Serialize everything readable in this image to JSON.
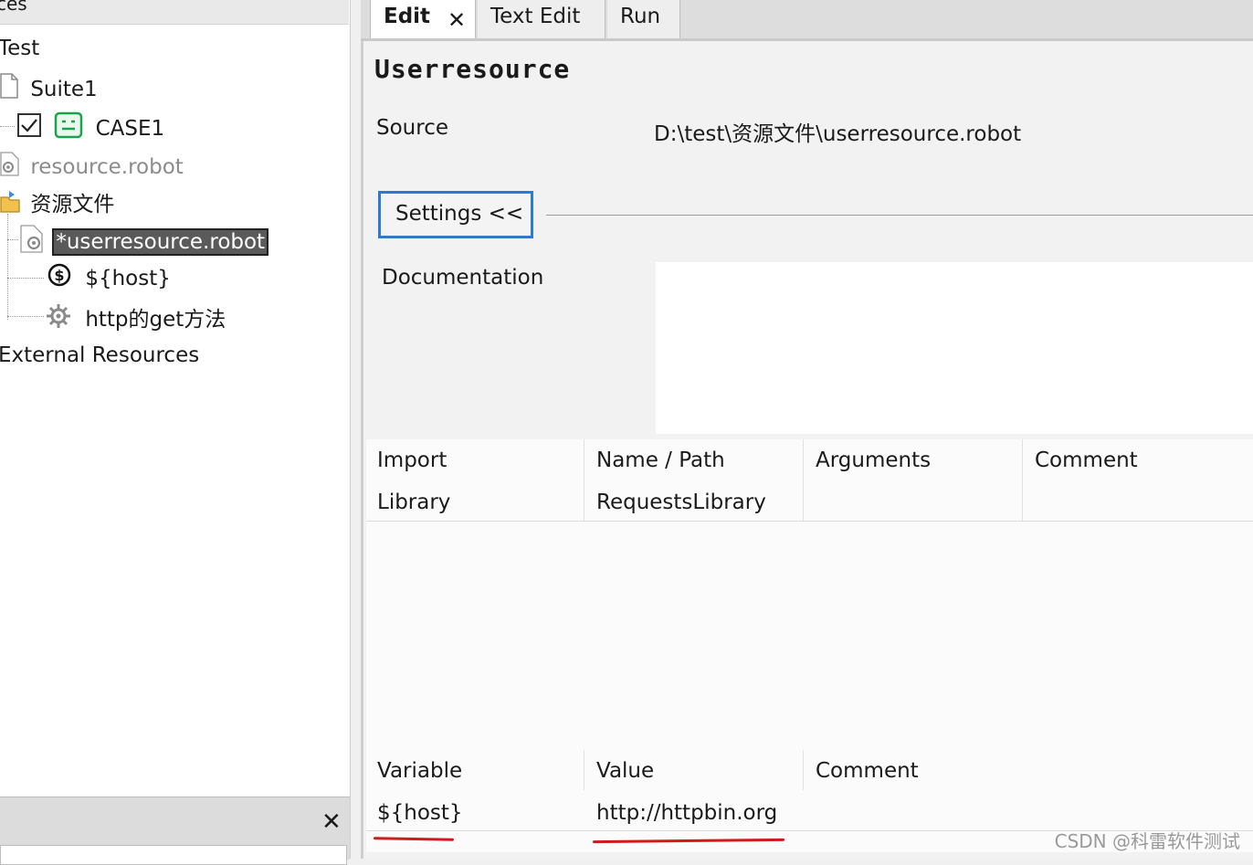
{
  "tree": {
    "header_label": "ces",
    "project": "Test",
    "suite": "Suite1",
    "test_case": "CASE1",
    "resource_file": "resource.robot",
    "folder": "资源文件",
    "selected_resource": "*userresource.robot",
    "variable_item": "${host}",
    "keyword_item": "http的get方法",
    "external_resources": "External Resources"
  },
  "tabs": [
    {
      "label": "Edit",
      "active": true
    },
    {
      "label": "Text Edit",
      "active": false
    },
    {
      "label": "Run",
      "active": false
    }
  ],
  "editor": {
    "title": "Userresource",
    "source_label": "Source",
    "source_value": "D:\\test\\资源文件\\userresource.robot",
    "settings_button": "Settings <<",
    "documentation_label": "Documentation",
    "imports": {
      "headers": [
        "Import",
        "Name / Path",
        "Arguments",
        "Comment"
      ],
      "rows": [
        [
          "Library",
          "RequestsLibrary",
          "",
          ""
        ]
      ]
    },
    "variables": {
      "headers": [
        "Variable",
        "Value",
        "Comment"
      ],
      "rows": [
        [
          "${host}",
          "http://httpbin.org",
          ""
        ]
      ]
    }
  },
  "watermark": "CSDN @科雷软件测试",
  "colors": {
    "settings_border": "#2d7bd0",
    "annotation_red": "#d11a1a",
    "selection_bg": "#5a5a5a",
    "case_icon_green": "#1aa34a"
  },
  "icons": [
    "file-icon",
    "checkbox-checked-icon",
    "test-case-icon",
    "resource-gear-icon",
    "folder-icon",
    "dollar-variable-icon",
    "keyword-gear-icon",
    "close-icon"
  ]
}
